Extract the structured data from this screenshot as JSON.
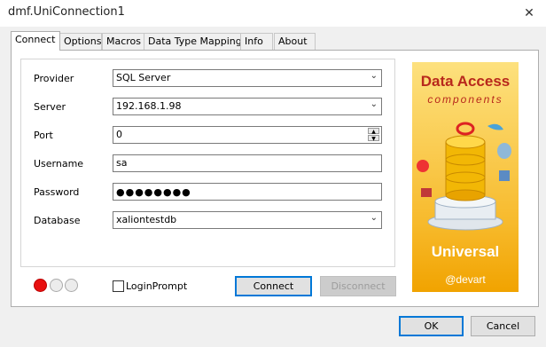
{
  "window": {
    "title": "dmf.UniConnection1",
    "close_glyph": "✕"
  },
  "tabs": [
    {
      "label": "Connect",
      "active": true
    },
    {
      "label": "Options"
    },
    {
      "label": "Macros"
    },
    {
      "label": "Data Type Mapping"
    },
    {
      "label": "Info"
    },
    {
      "label": "About"
    }
  ],
  "form": {
    "provider": {
      "label": "Provider",
      "value": "SQL Server"
    },
    "server": {
      "label": "Server",
      "value": "192.168.1.98"
    },
    "port": {
      "label": "Port",
      "value": "0"
    },
    "username": {
      "label": "Username",
      "value": "sa"
    },
    "password": {
      "label": "Password",
      "value": "●●●●●●●●"
    },
    "database": {
      "label": "Database",
      "value": "xaliontestdb"
    }
  },
  "status_leds": [
    {
      "color": "#e81010"
    },
    {
      "color": "#ececec"
    },
    {
      "color": "#ececec"
    }
  ],
  "login_prompt": {
    "label": "LoginPrompt",
    "checked": false
  },
  "buttons": {
    "connect": "Connect",
    "disconnect": "Disconnect",
    "ok": "OK",
    "cancel": "Cancel"
  },
  "logo": {
    "line1": "Data Access",
    "line2": "components",
    "line3": "Universal",
    "line4": "@devart"
  },
  "colors": {
    "accent": "#0078d7",
    "logo_text": "#b8281c"
  }
}
